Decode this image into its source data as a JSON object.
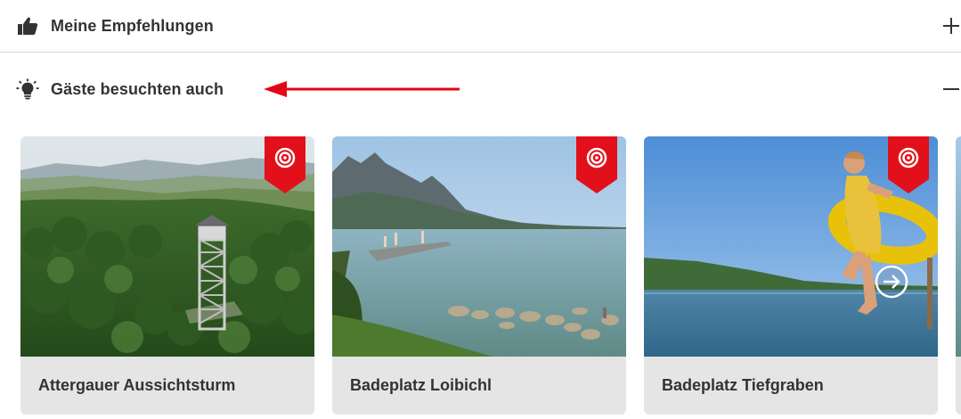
{
  "accordion": {
    "recommendations": {
      "title": "Meine Empfehlungen",
      "icon": "thumbs-up-icon",
      "state": "collapsed"
    },
    "guests_also_visited": {
      "title": "Gäste besuchten auch",
      "icon": "lightbulb-icon",
      "state": "expanded"
    }
  },
  "annotation": {
    "color": "#e30613"
  },
  "cards": [
    {
      "title": "Attergauer Aussichtsturm",
      "badge_icon": "target-icon"
    },
    {
      "title": "Badeplatz Loibichl",
      "badge_icon": "target-icon"
    },
    {
      "title": "Badeplatz Tiefgraben",
      "badge_icon": "target-icon"
    }
  ],
  "carousel": {
    "next_icon": "arrow-right-circle-icon"
  },
  "colors": {
    "badge": "#e2101a",
    "text": "#333333",
    "card_bg": "#e5e5e5",
    "divider": "#d9d9d9"
  }
}
